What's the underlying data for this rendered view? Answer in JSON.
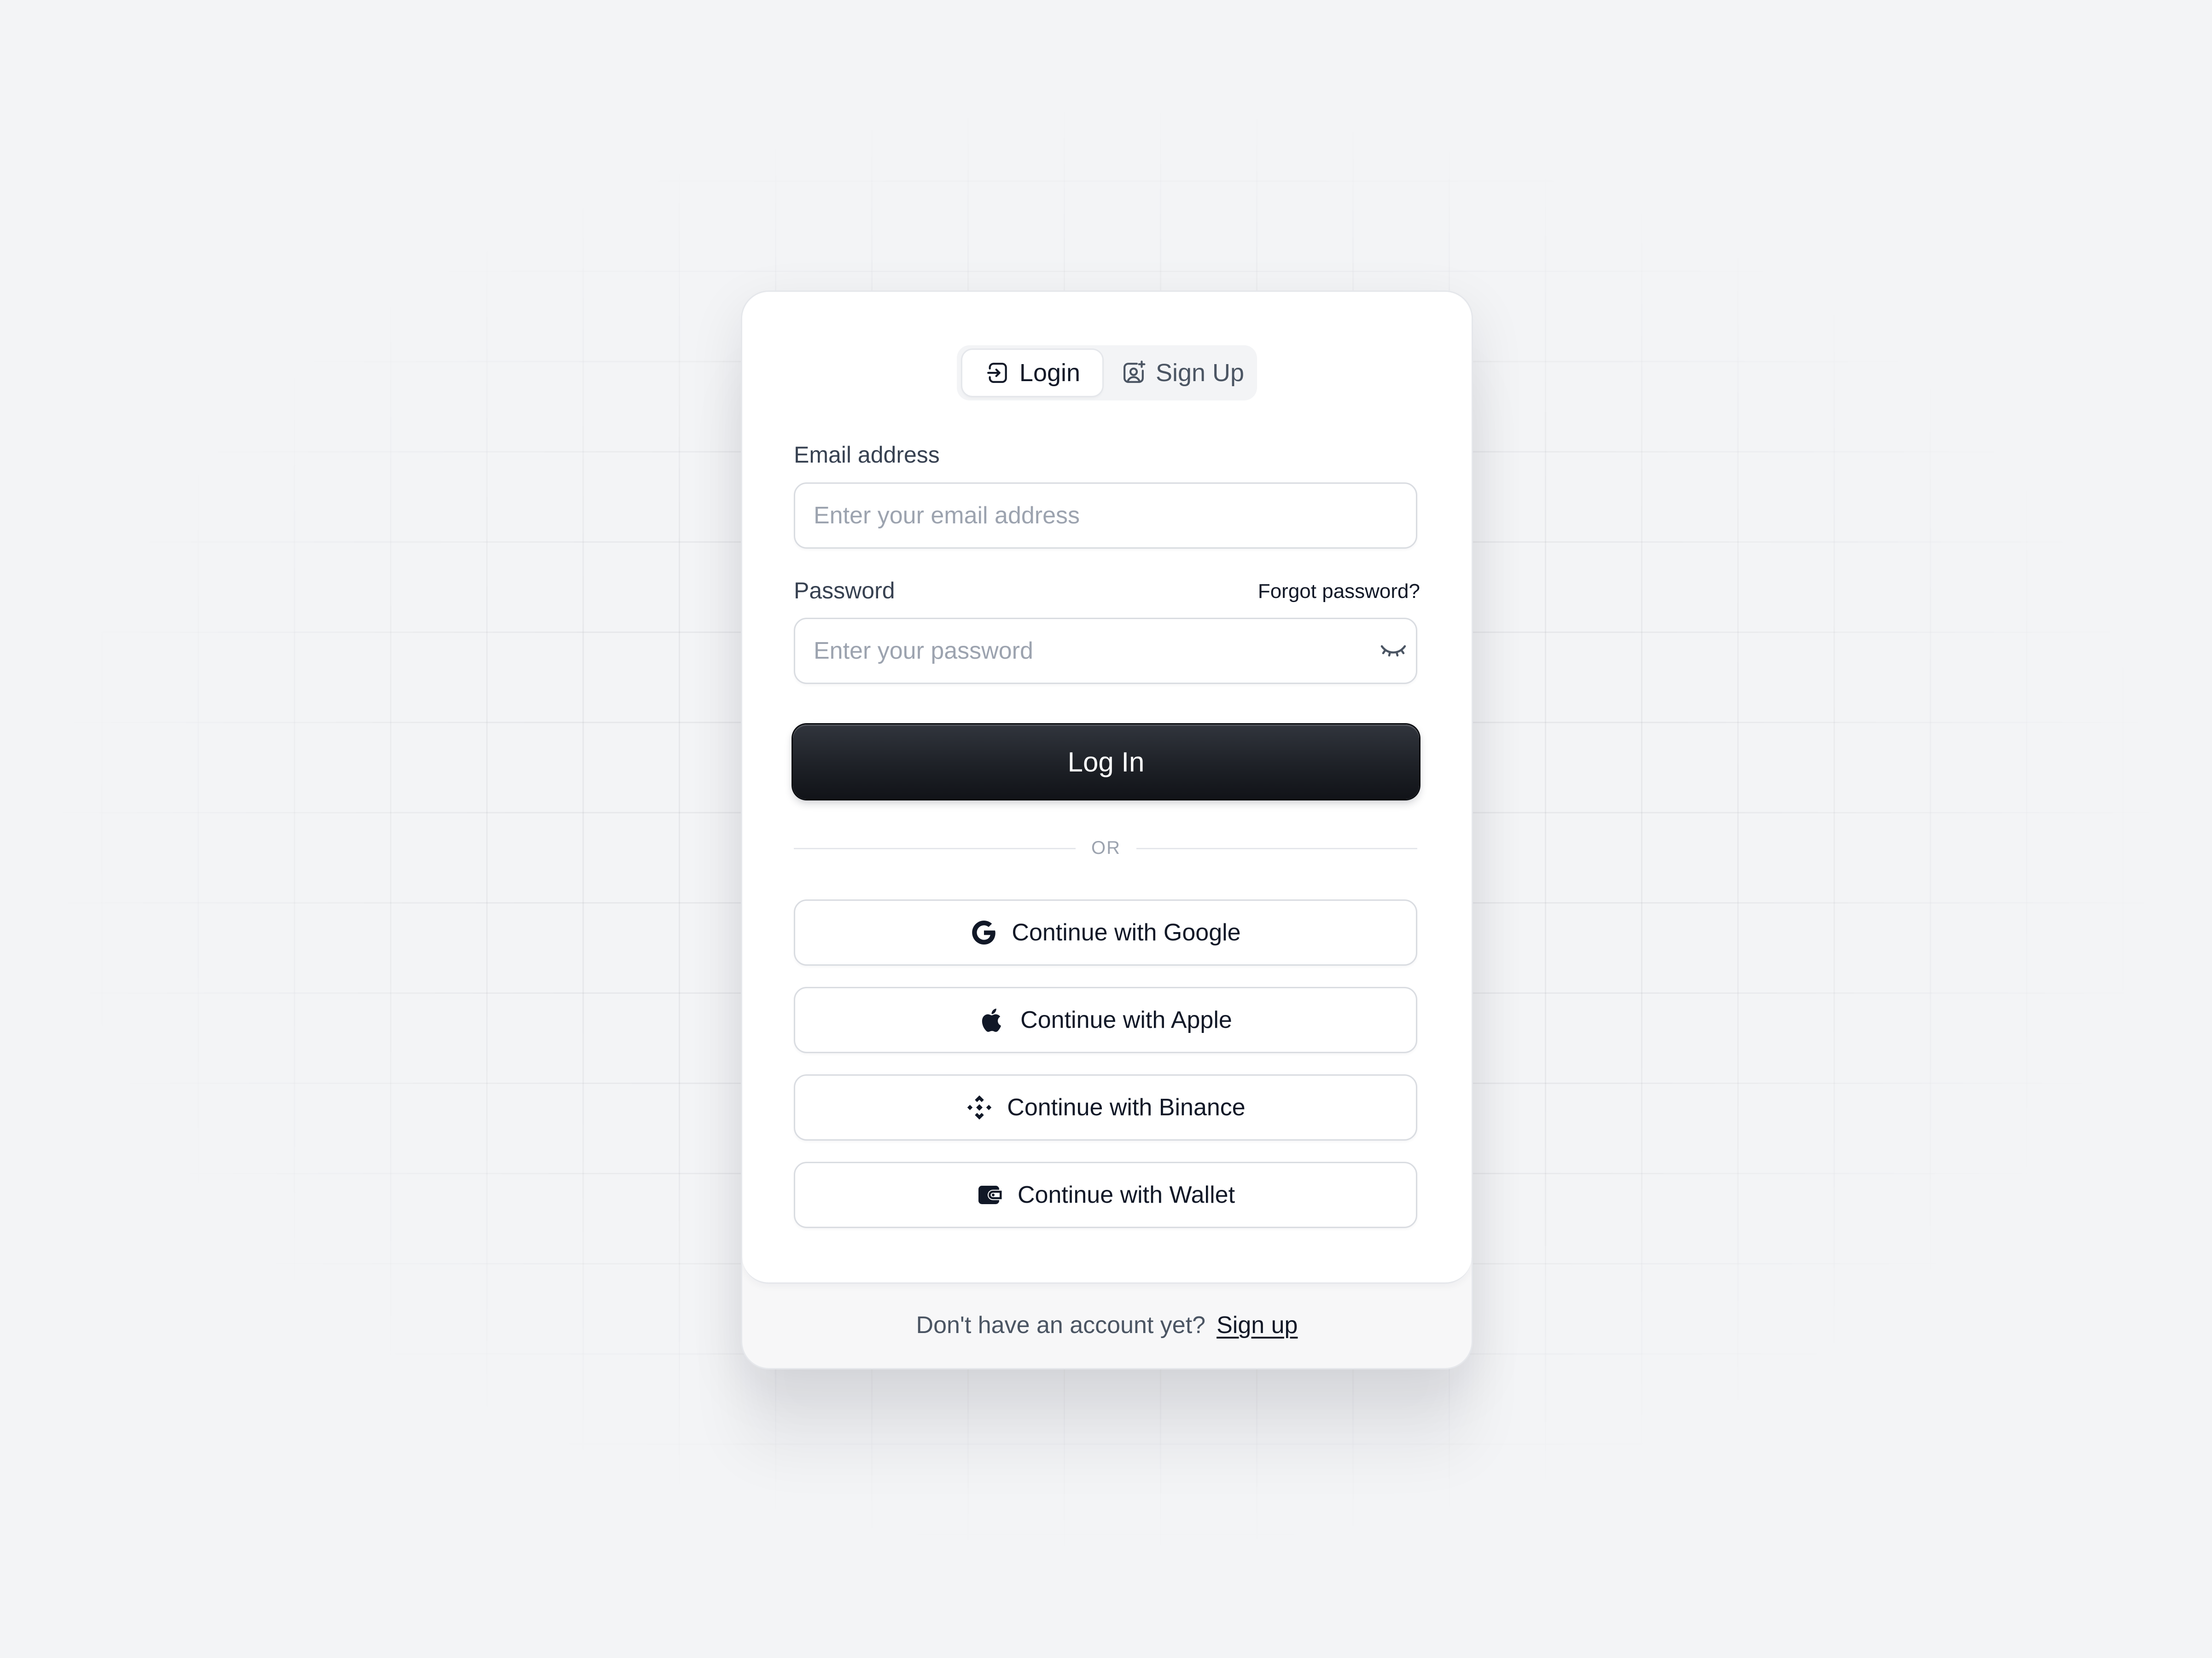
{
  "tabs": {
    "login": "Login",
    "signup": "Sign Up"
  },
  "form": {
    "email_label": "Email address",
    "email_placeholder": "Enter your email address",
    "password_label": "Password",
    "forgot_password": "Forgot password?",
    "password_placeholder": "Enter your password",
    "submit_label": "Log In"
  },
  "divider_text": "OR",
  "social": {
    "google": "Continue with Google",
    "apple": "Continue with Apple",
    "binance": "Continue with Binance",
    "wallet": "Continue with Wallet"
  },
  "footer": {
    "text": "Don't have an account yet?",
    "link": "Sign up"
  },
  "icons": {
    "login_tab": "login-icon",
    "signup_tab": "user-add-icon",
    "password_toggle": "eye-closed-icon",
    "google": "google-icon",
    "apple": "apple-icon",
    "binance": "binance-icon",
    "wallet": "wallet-icon"
  },
  "colors": {
    "page_background": "#f3f4f6",
    "card_background": "#ffffff",
    "primary_button": "#1e2127",
    "text_primary": "#111827",
    "text_muted": "#9ca3af"
  }
}
